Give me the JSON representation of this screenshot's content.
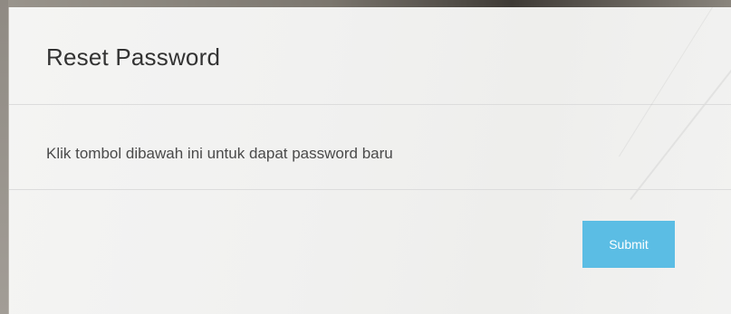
{
  "modal": {
    "title": "Reset Password",
    "message": "Klik tombol dibawah ini untuk dapat password baru",
    "submit_label": "Submit"
  },
  "colors": {
    "accent": "#5bbde4",
    "panel_background": "#f2f2f1",
    "title_text": "#333333",
    "body_text": "#4a4a4a",
    "divider": "#dcdcdc"
  }
}
